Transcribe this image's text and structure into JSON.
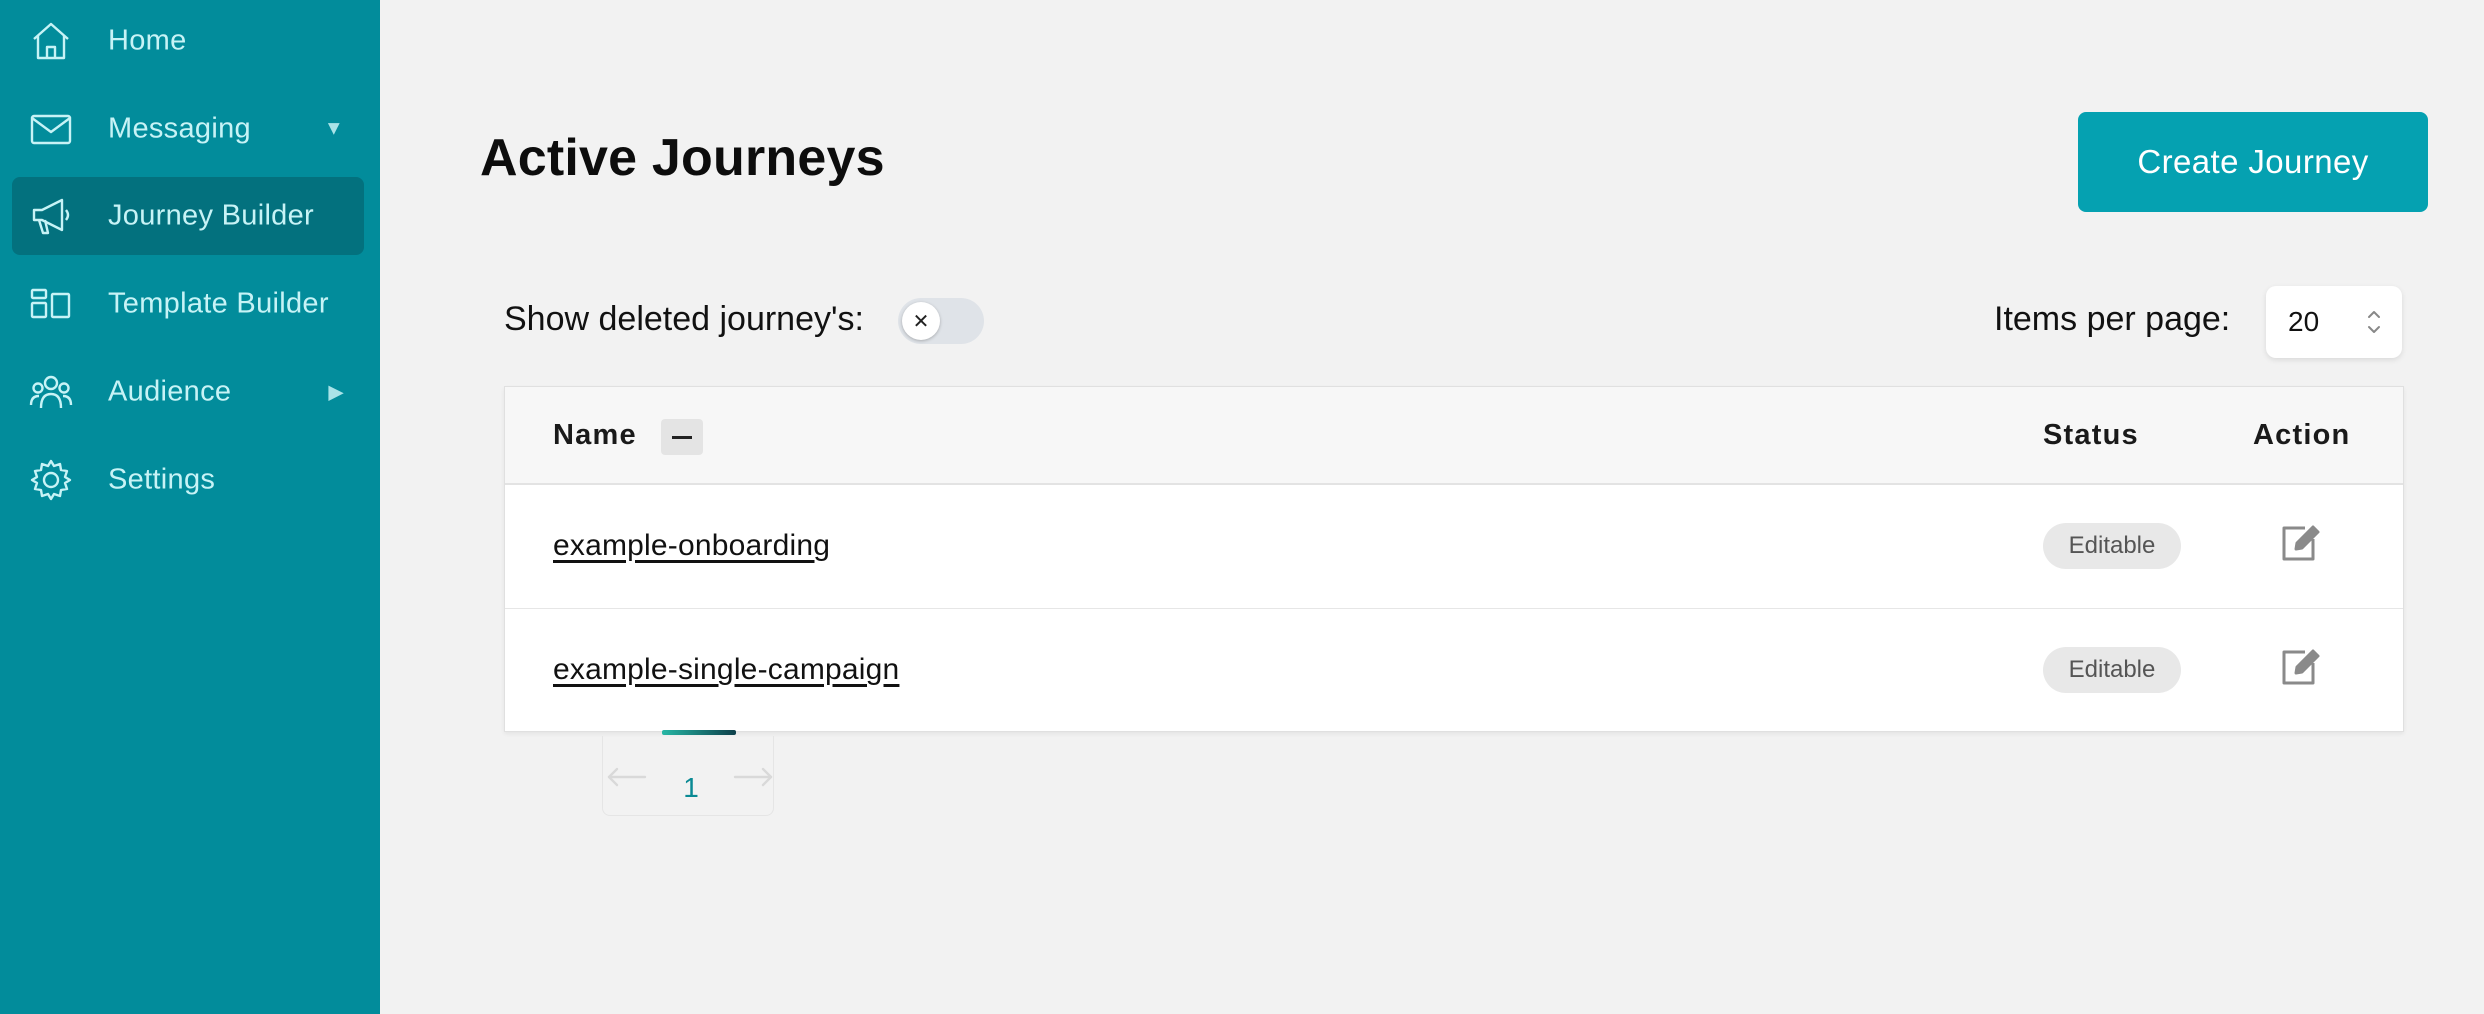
{
  "sidebar": {
    "items": [
      {
        "label": "Home",
        "icon": "home-icon"
      },
      {
        "label": "Messaging",
        "icon": "mail-icon",
        "caret": "▼"
      },
      {
        "label": "Journey Builder",
        "icon": "megaphone-icon",
        "active": true
      },
      {
        "label": "Template Builder",
        "icon": "layout-icon"
      },
      {
        "label": "Audience",
        "icon": "users-icon",
        "caret": "▶"
      },
      {
        "label": "Settings",
        "icon": "gear-icon"
      }
    ]
  },
  "main": {
    "title": "Active Journeys",
    "create_button": "Create Journey",
    "show_deleted_label": "Show deleted journey's:",
    "toggle_off_glyph": "✕",
    "items_per_page_label": "Items per page:",
    "items_per_page_value": "20",
    "table": {
      "columns": [
        "Name",
        "Status",
        "Action"
      ],
      "rows": [
        {
          "name": "example-onboarding",
          "status": "Editable"
        },
        {
          "name": "example-single-campaign",
          "status": "Editable"
        }
      ]
    },
    "pagination": {
      "current_page": "1"
    }
  },
  "colors": {
    "sidebar_bg": "#028c9b",
    "sidebar_active_bg": "#03717e",
    "sidebar_text": "#c7f3f6",
    "accent_button": "#05a1b1",
    "page_bg": "#f2f2f2"
  }
}
